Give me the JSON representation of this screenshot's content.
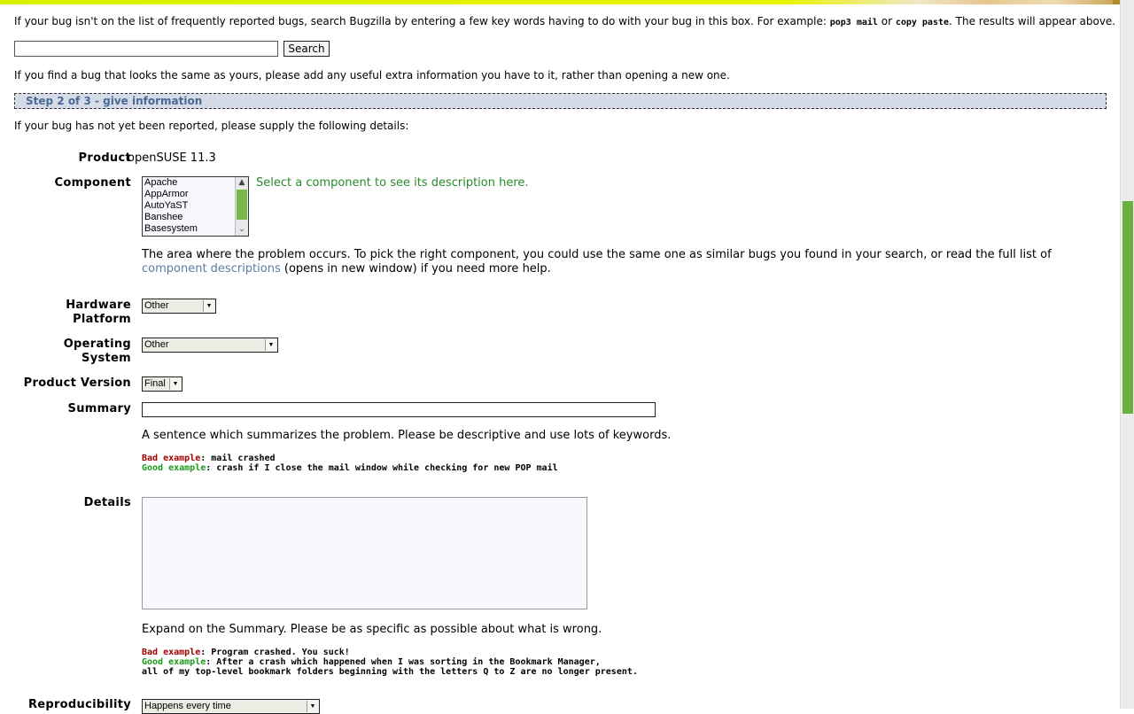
{
  "search_section": {
    "intro_before": "If your bug isn't on the list of frequently reported bugs, search Bugzilla by entering a few key words having to do with your bug in this box. For example: ",
    "example1": "pop3 mail",
    "or_word": " or ",
    "example2": "copy paste",
    "intro_after": ". The results will appear above.",
    "search_input_value": "",
    "search_button_label": "Search",
    "duplicate_note": "If you find a bug that looks the same as yours, please add any useful extra information you have to it, rather than opening a new one."
  },
  "step": {
    "title": "Step 2 of 3 - give information",
    "supply_text": "If your bug has not yet been reported, please supply the following details:"
  },
  "form": {
    "product_label": "Product",
    "product_value": "openSUSE 11.3",
    "component_label": "Component",
    "component_options": [
      "Apache",
      "AppArmor",
      "AutoYaST",
      "Banshee",
      "Basesystem"
    ],
    "component_desc": "Select a component to see its description here.",
    "component_help_line1": "The area where the problem occurs. To pick the right component, you could use the same one as similar bugs you found in your search, or read the full list of",
    "component_help_link": "component descriptions",
    "component_help_line2": " (opens in new window) if you need more help.",
    "hardware_label_1": "Hardware",
    "hardware_label_2": "Platform",
    "hardware_value": "Other",
    "os_label_1": "Operating",
    "os_label_2": "System",
    "os_value": "Other",
    "version_label": "Product Version",
    "version_value": "Final",
    "summary_label": "Summary",
    "summary_value": "",
    "summary_help": "A sentence which summarizes the problem. Please be descriptive and use lots of keywords.",
    "summary_bad_label": "Bad example",
    "summary_bad_text": ": mail crashed",
    "summary_good_label": "Good example",
    "summary_good_text": ": crash if I close the mail window while checking for new POP mail",
    "details_label": "Details",
    "details_value": "",
    "details_help": "Expand on the Summary. Please be as specific as possible about what is wrong.",
    "details_bad_label": "Bad example",
    "details_bad_text": ": Program crashed. You suck!",
    "details_good_label": "Good example",
    "details_good_text": ": After a crash which happened when I was sorting in the Bookmark Manager,",
    "details_good_text2": "all of my top-level bookmark folders beginning with the letters Q to Z are no longer present.",
    "repro_label": "Reproducibility",
    "repro_value": "Happens every time"
  }
}
